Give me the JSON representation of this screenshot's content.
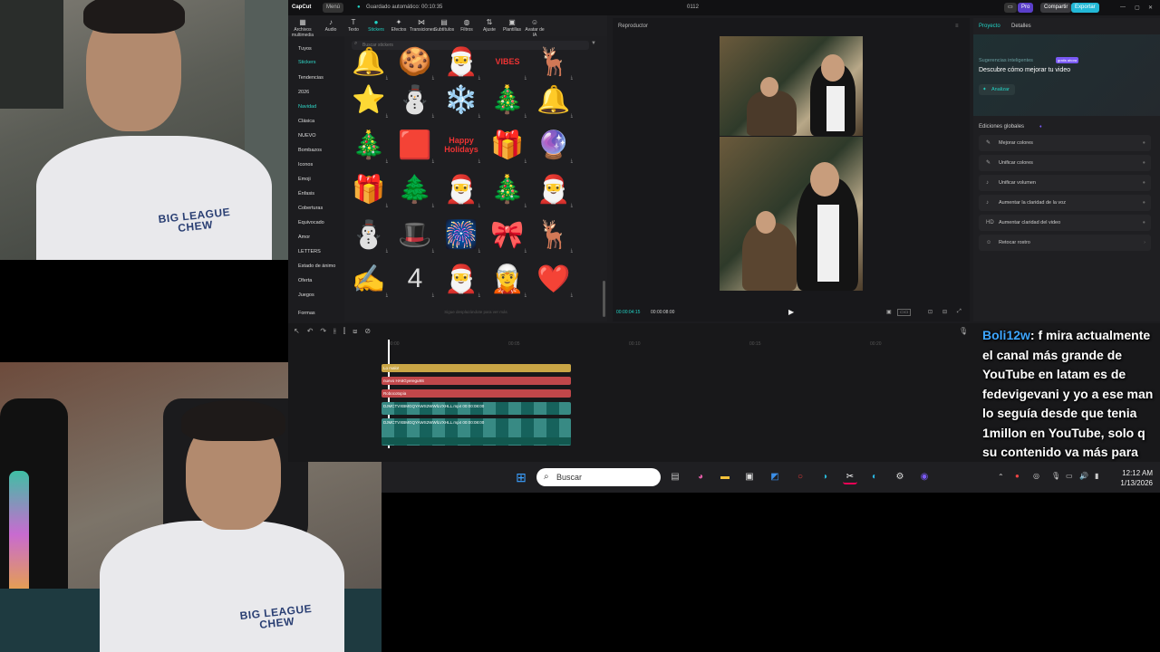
{
  "window": {
    "app_name": "CapCut",
    "menu_label": "Menú",
    "autosave_text": "Guardado automático: 00:10:35",
    "project_name": "0112",
    "pro_label": "Pro",
    "share_label": "Compartir",
    "export_label": "Exportar"
  },
  "toolbar": {
    "items": [
      {
        "label": "Archivos multimedia",
        "icon": "media-icon"
      },
      {
        "label": "Audio",
        "icon": "audio-icon"
      },
      {
        "label": "Texto",
        "icon": "text-icon"
      },
      {
        "label": "Stickers",
        "icon": "stickers-icon",
        "active": true
      },
      {
        "label": "Efectos",
        "icon": "effects-icon"
      },
      {
        "label": "Transiciones",
        "icon": "transitions-icon"
      },
      {
        "label": "Subtítulos",
        "icon": "subtitles-icon"
      },
      {
        "label": "Filtros",
        "icon": "filters-icon"
      },
      {
        "label": "Ajuste",
        "icon": "adjust-icon"
      },
      {
        "label": "Plantillas",
        "icon": "templates-icon"
      },
      {
        "label": "Avatar de IA",
        "icon": "ai-avatar-icon"
      }
    ]
  },
  "categories": [
    "Tuyos",
    "Stickers",
    "Tendencias",
    "2026",
    "Navidad",
    "Clásica",
    "NUEVO",
    "Bombazos",
    "Iconos",
    "Emoji",
    "Énfasis",
    "Coberturas",
    "Equivocado",
    "Amor",
    "LETTERS",
    "Estado de ánimo",
    "Oferta",
    "Juegos",
    "Formas"
  ],
  "active_category": "Navidad",
  "search_placeholder": "Buscar stickers",
  "stickers_footer": "Sigue desplazándote para ver más",
  "stickers": [
    {
      "glyph": "🔔"
    },
    {
      "glyph": "🍪"
    },
    {
      "glyph": "🎅"
    },
    {
      "glyph": "VIBES"
    },
    {
      "glyph": "🦌"
    },
    {
      "glyph": "⭐"
    },
    {
      "glyph": "⛄"
    },
    {
      "glyph": "❄️"
    },
    {
      "glyph": "🎄"
    },
    {
      "glyph": "🔔"
    },
    {
      "glyph": "🎄"
    },
    {
      "glyph": "🟥"
    },
    {
      "glyph": "Happy Holidays"
    },
    {
      "glyph": "🎁"
    },
    {
      "glyph": "🔮"
    },
    {
      "glyph": "🎁"
    },
    {
      "glyph": "🌲"
    },
    {
      "glyph": "🎅"
    },
    {
      "glyph": "🎄"
    },
    {
      "glyph": "🎅"
    },
    {
      "glyph": "⛄"
    },
    {
      "glyph": "🎩"
    },
    {
      "glyph": "🎆"
    },
    {
      "glyph": "🎀"
    },
    {
      "glyph": "🦌"
    },
    {
      "glyph": "✍"
    },
    {
      "glyph": "4"
    },
    {
      "glyph": "🎅"
    },
    {
      "glyph": "🧝"
    },
    {
      "glyph": "❤️"
    }
  ],
  "player": {
    "title": "Reproductor",
    "current_time": "00:00:04:15",
    "total_time": "00:00:08:00"
  },
  "right_panel": {
    "tab_project": "Proyecto",
    "tab_details": "Detalles",
    "smart_title": "Sugerencias inteligentes",
    "smart_badge": "gratis ahora",
    "smart_subtitle": "Descubre cómo mejorar tu video",
    "analyze_label": "Analizar",
    "global_title": "Ediciones globales",
    "items": [
      "Mejorar colores",
      "Unificar colores",
      "Unificar volumen",
      "Aumentar la claridad de la voz",
      "Aumentar claridad del video",
      "Retocar rostro"
    ]
  },
  "timeline": {
    "ruler": [
      "00:00",
      "00:05",
      "00:10",
      "00:15",
      "00:20"
    ],
    "clips": [
      {
        "label": "Lo malo!",
        "color": "#c9a545"
      },
      {
        "label": "nuevo HA6Gyeregu9S",
        "color": "#c0474a"
      },
      {
        "label": "Robocotopia",
        "color": "#c0474a"
      },
      {
        "label": "DJMCTVXBMGQYAWS2WWlLVXHLL.mp4  00:00:08:00",
        "color": "#1c7a73"
      },
      {
        "label": "DJMCTVXBMGQYAWS2WWlLVXHLL.mp4  00:00:08:00",
        "color": "#1c7a73"
      }
    ]
  },
  "caption": {
    "user": "Boli12w",
    "text_first": ": f mira actualmente",
    "text_rest": "el canal más grande de YouTube en latam es de fedevigevani y yo a ese man lo seguía desde que tenia 1millon en YouTube, solo q su contenido va más para niños"
  },
  "taskbar": {
    "search_label": "Buscar",
    "time": "12:12 AM",
    "date": "1/13/2026"
  },
  "webcam": {
    "shirt_text_line1": "BIG LEAGUE",
    "shirt_text_line2": "CHEW"
  },
  "colors": {
    "accent": "#22d3c5",
    "pro": "#7a5af5",
    "export": "#22c1d6"
  }
}
